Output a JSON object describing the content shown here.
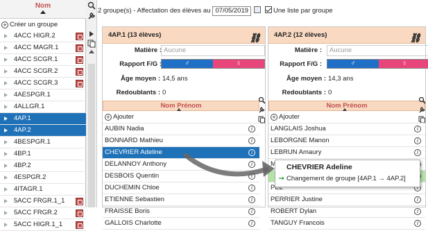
{
  "left_list": {
    "header": "Nom",
    "create_label": "Créer un groupe",
    "items": [
      {
        "label": "4ACC HIGR.2",
        "badge": true,
        "selected": false
      },
      {
        "label": "4ACC MAGR.1",
        "badge": true,
        "selected": false
      },
      {
        "label": "4ACC SCGR.1",
        "badge": true,
        "selected": false
      },
      {
        "label": "4ACC SCGR.2",
        "badge": true,
        "selected": false
      },
      {
        "label": "4ACC SCGR.3",
        "badge": true,
        "selected": false
      },
      {
        "label": "4AESPGR.1",
        "badge": false,
        "selected": false
      },
      {
        "label": "4ALLGR.1",
        "badge": false,
        "selected": false
      },
      {
        "label": "4AP.1",
        "badge": false,
        "selected": true
      },
      {
        "label": "4AP.2",
        "badge": false,
        "selected": true
      },
      {
        "label": "4BESPGR.1",
        "badge": false,
        "selected": false
      },
      {
        "label": "4BP.1",
        "badge": false,
        "selected": false
      },
      {
        "label": "4BP.2",
        "badge": false,
        "selected": false
      },
      {
        "label": "4ESPGR.2",
        "badge": false,
        "selected": false
      },
      {
        "label": "4ITAGR.1",
        "badge": false,
        "selected": false
      },
      {
        "label": "5ACC FRGR.1_1",
        "badge": true,
        "selected": false
      },
      {
        "label": "5ACC FRGR.2",
        "badge": true,
        "selected": false
      },
      {
        "label": "5ACC HIGR.1_1",
        "badge": true,
        "selected": false
      }
    ]
  },
  "topbar": {
    "text": "2 groupe(s) - Affectation des élèves au",
    "date": "07/05/2019",
    "checkbox_label": "Une liste par groupe"
  },
  "panels": [
    {
      "title": "4AP.1 (13 élèves)",
      "matiere_label": "Matière :",
      "matiere_value": "Aucune",
      "rapport_label": "Rapport F/G :",
      "age_label": "Âge moyen :",
      "age_value": "14,5 ans",
      "redoublants_label": "Redoublants :",
      "redoublants_value": "0",
      "names_header": "Nom Prénom",
      "add_label": "Ajouter",
      "students": [
        "AUBIN Nadia",
        "BONNARD Mathieu",
        "CHEVRIER Adeline",
        "DELANNOY Anthony",
        "DESBOIS Quentin",
        "DUCHEMIN Chloe",
        "ETIENNE Sebastien",
        "FRAISSE Boris",
        "GALLOIS Charlotte"
      ],
      "selected_index": 2
    },
    {
      "title": "4AP.2 (12 élèves)",
      "matiere_label": "Matière :",
      "matiere_value": "Aucune",
      "rapport_label": "Rapport F/G :",
      "age_label": "Âge moyen :",
      "age_value": "14,3 ans",
      "redoublants_label": "Redoublants :",
      "redoublants_value": "0",
      "names_header": "Nom Prénom",
      "add_label": "Ajouter",
      "students": [
        "LANGLAIS Joshua",
        "LEBORGNE Manon",
        "LEBRUN Amaury",
        "MARTIN Zakaria",
        "",
        "PEL",
        "PERRIER Justine",
        "ROBERT Dylan",
        "TANGUY Francois"
      ],
      "selected_index": -1
    }
  ],
  "drag": {
    "name": "CHEVRIER Adeline",
    "action": "Changement de groupe [4AP.1 → 4AP.2]"
  },
  "colors": {
    "selection": "#1f71b8",
    "header_bg": "#f9d9c2",
    "accent_red": "#c0504d",
    "male": "#1e6fc5",
    "female": "#e8457a"
  }
}
